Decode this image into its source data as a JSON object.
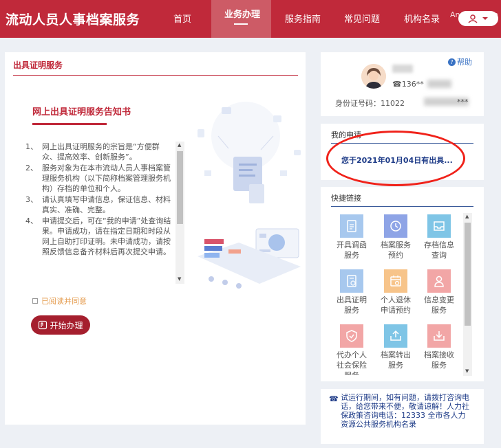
{
  "header": {
    "brand": "流动人员人事档案服务",
    "nav": [
      "首页",
      "业务办理",
      "服务指南",
      "常见问题",
      "机构名录"
    ],
    "active_nav": "业务办理",
    "watermark": "Answeb.com"
  },
  "main": {
    "panel_title": "出具证明服务",
    "notice_title": "网上出具证明服务告知书",
    "notice_items": [
      {
        "num": "1、",
        "text": "网上出具证明服务的宗旨是“方便群众、提高效率、创新服务”。"
      },
      {
        "num": "2、",
        "text": "服务对象为在本市流动人员人事档案管理服务机构（以下简称档案管理服务机构）存档的单位和个人。"
      },
      {
        "num": "3、",
        "text": "请认真填写申请信息，保证信息、材料真实、准确、完整。"
      },
      {
        "num": "4、",
        "text": "申请提交后，可在“我的申请”处查询结果。申请成功，请在指定日期和时段从网上自助打印证明。未申请成功，请按照反馈信息备齐材料后再次提交申请。"
      }
    ],
    "agree_label": "已阅读并同意",
    "start_button": "开始办理"
  },
  "user": {
    "help": "帮助",
    "phone": "☎136**",
    "id_label": "身份证号码：11022",
    "id_tail": "***"
  },
  "my_applications": {
    "title": "我的申请",
    "entry": "您于2021年01月04日有出具..."
  },
  "quick_links": {
    "title": "快捷链接",
    "items": [
      {
        "label": "开具调函服务",
        "icon": "document-icon",
        "color": "#a7c8ee"
      },
      {
        "label": "档案服务预约",
        "icon": "clock-icon",
        "color": "#8ea4e6"
      },
      {
        "label": "存档信息查询",
        "icon": "inbox-icon",
        "color": "#7fc5e6"
      },
      {
        "label": "出具证明服务",
        "icon": "certificate-icon",
        "color": "#a7c8ee"
      },
      {
        "label": "个人退休申请预约",
        "icon": "calendar-icon",
        "color": "#f7c48a"
      },
      {
        "label": "信息变更服务",
        "icon": "person-icon",
        "color": "#f2a6a6"
      },
      {
        "label": "代办个人社会保险服务",
        "icon": "shield-icon",
        "color": "#f2a6a6"
      },
      {
        "label": "档案转出服务",
        "icon": "export-icon",
        "color": "#7fc5e6"
      },
      {
        "label": "档案接收服务",
        "icon": "import-icon",
        "color": "#f2a6a6"
      }
    ]
  },
  "contact": {
    "text": "试运行期间，如有问题，请拨打咨询电话，给您带来不便，敬请谅解！人力社保政策咨询电话：12333 全市各人力资源公共服务机构名录"
  },
  "colors": {
    "brand_red": "#c0293a",
    "highlight_ring": "#f0221a",
    "link_blue": "#1f3c88"
  }
}
